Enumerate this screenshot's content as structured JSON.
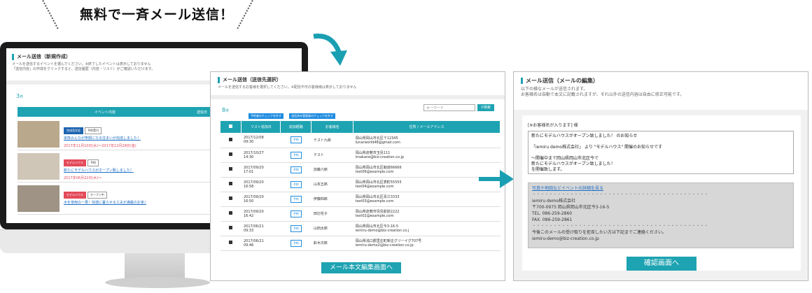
{
  "headline": "無料で一斉メール送信！",
  "screen1": {
    "title": "メール送信（新規作成）",
    "desc1": "メールを送信するイベントを選んでください。※終了したイベントは表示しておりません",
    "desc2": "「送信内容」の作成をクリックすると、送信履歴（内容・リスト）がご確認いただけます。",
    "count": "3",
    "count_unit": "件",
    "col_event": "イベント内容",
    "col_send": "送信日",
    "events": [
      {
        "tag1": "完成見学会",
        "tag2": "予約受付",
        "link": "家族みんなが笑顔になる住まいが完成しました！",
        "date": "2017年11月10日(水)〜2017年12月29日(金)",
        "tag1_color": "#1e64b0"
      },
      {
        "tag1": "モデルハウス",
        "tag2": "予約",
        "link": "新たにモデルハウスがオープン致しました！",
        "date": "2017年06月22日(木)〜",
        "tag1_color": "#e34a5a"
      },
      {
        "tag1": "モデルハウス",
        "tag2": "オープン中",
        "link": "木を使用の一貫！快適に暮らせる工夫が満載のお家♪",
        "date": "",
        "tag1_color": "#e34a5a"
      }
    ]
  },
  "screen2": {
    "title": "メール送信（送信先選択）",
    "desc": "メールを送信するお客様を選択してください。※配信不可の客様様は表示しておりません",
    "count": "8",
    "count_unit": "件",
    "btn_all_reserve": "予約者のチェックを外す",
    "btn_all_manage": "送信済み管理者のチェックを外す",
    "search_placeholder": "キーワード",
    "search_btn": "検索",
    "headers": [
      "",
      "リスト追加日",
      "追加経路",
      "お客様名",
      "住所 / メールアドレス"
    ],
    "route_label": "予約",
    "rows": [
      {
        "date": "2017/12/08",
        "time": "09:30",
        "name": "テスト九郎",
        "addr": "岡山県岡山市北区〒12345",
        "mail": "lunarworld48@gmail.com"
      },
      {
        "date": "2017/10/27",
        "time": "14:30",
        "name": "テスト",
        "addr": "岡山県倉敷市玉島111",
        "mail": "imakane@biz-creation.co.jp"
      },
      {
        "date": "2017/09/20",
        "time": "17:01",
        "name": "加藤六郎",
        "addr": "岡山県岡山市北区勅道66666",
        "mail": "test06@example.com"
      },
      {
        "date": "2017/09/20",
        "time": "16:58",
        "name": "山本五郎",
        "addr": "岡山県岡山市北区表町55555",
        "mail": "test04@example.com"
      },
      {
        "date": "2017/09/20",
        "time": "16:50",
        "name": "伊藤四郎",
        "addr": "岡山県岡山市北区青江3333",
        "mail": "test03@example.com"
      },
      {
        "date": "2017/09/20",
        "time": "16:42",
        "name": "田辺花子",
        "addr": "岡山県倉敷市児島駅前2222",
        "mail": "test02@example.com"
      },
      {
        "date": "2017/06/21",
        "time": "09:33",
        "name": "山田太郎",
        "addr": "岡山県岡山市北区今3-16-5",
        "mail": "iemiru-demo@biz-creation.co.j"
      },
      {
        "date": "2017/06/21",
        "time": "09:46",
        "name": "鈴木次郎",
        "addr": "岡山県浅口郡里庄町新庄グリーイグ707号",
        "mail": "iemiru-demo2@biz-creation.co.jp"
      }
    ],
    "submit": "メール本文編集画面へ"
  },
  "screen3": {
    "title": "メール送信（メールの編集）",
    "desc1": "以下の様なメールが送信されます。",
    "desc2": "お客様名は自動で本文に記載されますが、それ以外の送信内容は自由に修正可能です。",
    "greeting": "[※お客様名が入ります] 様",
    "message": "新たにモデルハウスがオープン致しました！ のお知らせ\n\n「iemiru demo株式会社」 より \"モデルハウス\" 開催のお知らせです\n\n〜開催中まで岡山県岡山市北区今で\n新たにモデルハウスがオープン致しました！\nを開催致します。",
    "sig_link": "写真や地図などイベントの詳細を見る",
    "sig_company": "iemiru demo株式会社",
    "sig_addr": "〒700-0975 岡山県岡山市北区今3-16-5",
    "sig_tel": "TEL. 086-259-2860",
    "sig_fax": "FAX. 086-259-2861",
    "sig_note": "今後このメールの受け取りを拒否したい方は下記までご連絡ください。",
    "sig_mail": "iemiru-demo@biz-creation.co.jp",
    "dots": "・・・・・・・・・・・・・・・・・・・・・・・・・・・・・・・・・・・・・・・・・・",
    "confirm": "確認画面へ"
  },
  "colors": {
    "accent": "#1ea3b2",
    "link": "#1f6fc5",
    "red": "#e34a5a"
  }
}
